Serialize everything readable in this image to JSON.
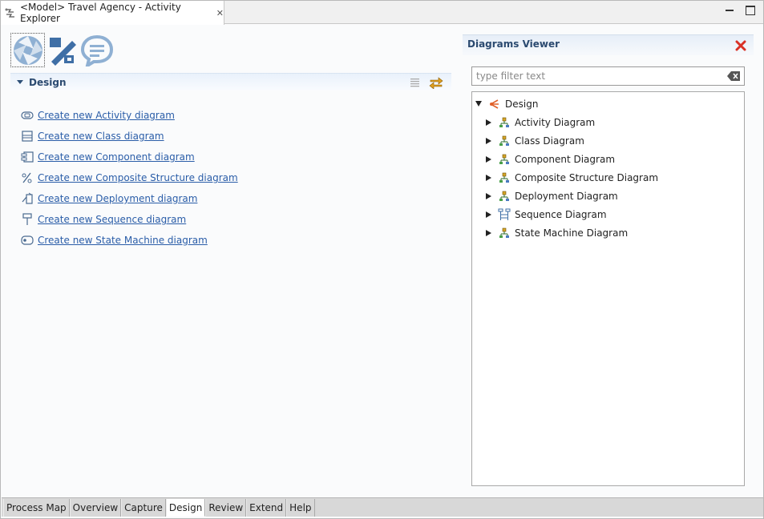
{
  "editor_tab": {
    "title": "<Model> Travel Agency - Activity Explorer",
    "icon": "activity-explorer-icon",
    "close_icon": "close-x-icon"
  },
  "window_controls": [
    "minimize-icon",
    "maximize-icon"
  ],
  "toolbar": {
    "icons": [
      {
        "name": "activity-explorer-aperture-icon",
        "selected": true
      },
      {
        "name": "pencil-edit-icon",
        "selected": false
      },
      {
        "name": "speech-bubble-icon",
        "selected": false
      }
    ]
  },
  "design_section": {
    "title": "Design",
    "links": [
      {
        "label": "Create new Activity diagram",
        "icon": "activity-diagram-icon"
      },
      {
        "label": "Create new Class diagram",
        "icon": "class-diagram-icon"
      },
      {
        "label": "Create new Component diagram",
        "icon": "component-diagram-icon"
      },
      {
        "label": "Create new Composite Structure diagram",
        "icon": "composite-structure-icon"
      },
      {
        "label": "Create new Deployment diagram",
        "icon": "deployment-diagram-icon"
      },
      {
        "label": "Create new Sequence diagram",
        "icon": "sequence-diagram-icon"
      },
      {
        "label": "Create new State Machine diagram",
        "icon": "state-machine-icon"
      }
    ]
  },
  "diagrams_viewer": {
    "title": "Diagrams Viewer",
    "filter_placeholder": "type filter text",
    "root": {
      "label": "Design",
      "icon": "design-root-icon"
    },
    "children": [
      {
        "label": "Activity Diagram",
        "icon": "diagram-tree-icon"
      },
      {
        "label": "Class Diagram",
        "icon": "diagram-tree-icon"
      },
      {
        "label": "Component Diagram",
        "icon": "diagram-tree-icon"
      },
      {
        "label": "Composite Structure Diagram",
        "icon": "diagram-tree-icon"
      },
      {
        "label": "Deployment Diagram",
        "icon": "diagram-tree-icon"
      },
      {
        "label": "Sequence Diagram",
        "icon": "sequence-tree-icon"
      },
      {
        "label": "State Machine Diagram",
        "icon": "diagram-tree-icon"
      }
    ]
  },
  "bottom_tabs": [
    {
      "label": "Process Map",
      "active": false
    },
    {
      "label": "Overview",
      "active": false
    },
    {
      "label": "Capture",
      "active": false
    },
    {
      "label": "Design",
      "active": true
    },
    {
      "label": "Review",
      "active": false
    },
    {
      "label": "Extend",
      "active": false
    },
    {
      "label": "Help",
      "active": false
    }
  ],
  "colors": {
    "link": "#2a5da8",
    "section_title": "#2b4a70",
    "close_red": "#d93025",
    "icon_blue": "#3f6fa6"
  }
}
